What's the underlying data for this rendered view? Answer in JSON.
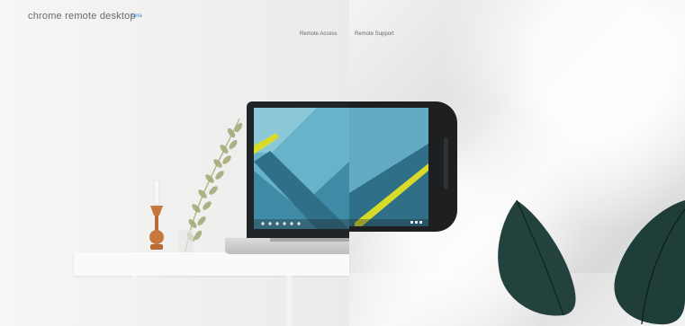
{
  "header": {
    "title": "chrome remote desktop",
    "beta": "beta"
  },
  "nav": {
    "remote_access": "Remote Access",
    "remote_support": "Remote Support"
  },
  "colors": {
    "accent_blue": "#4f8ed7",
    "screen_teal": "#3f8aa5",
    "screen_yellow": "#d8db2a",
    "leaf_green": "#23423d"
  },
  "icons": {
    "laptop": "chromebook-laptop",
    "phone": "android-phone",
    "plant": "eucalyptus-branch",
    "candle": "candle-holder",
    "leaf": "fig-leaf"
  }
}
